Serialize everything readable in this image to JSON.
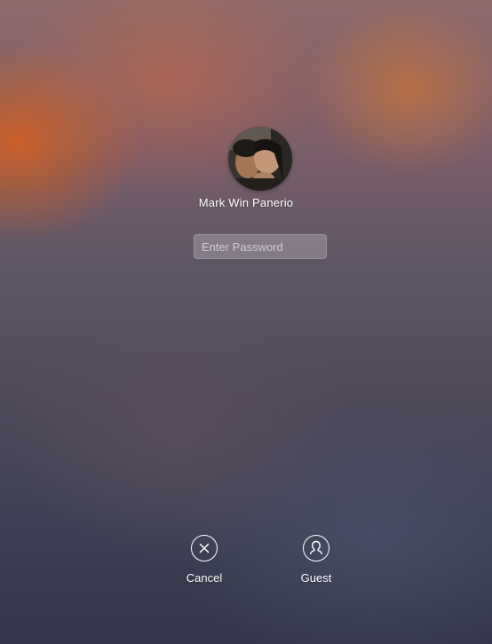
{
  "user": {
    "name": "Mark Win Panerio"
  },
  "password": {
    "placeholder": "Enter Password",
    "value": ""
  },
  "actions": {
    "cancel": {
      "label": "Cancel",
      "icon": "close-circle-icon"
    },
    "guest": {
      "label": "Guest",
      "icon": "guest-user-icon"
    }
  },
  "colors": {
    "text": "#ffffff",
    "wallpaper_top": "#c86a3a",
    "wallpaper_bottom": "#333648"
  }
}
